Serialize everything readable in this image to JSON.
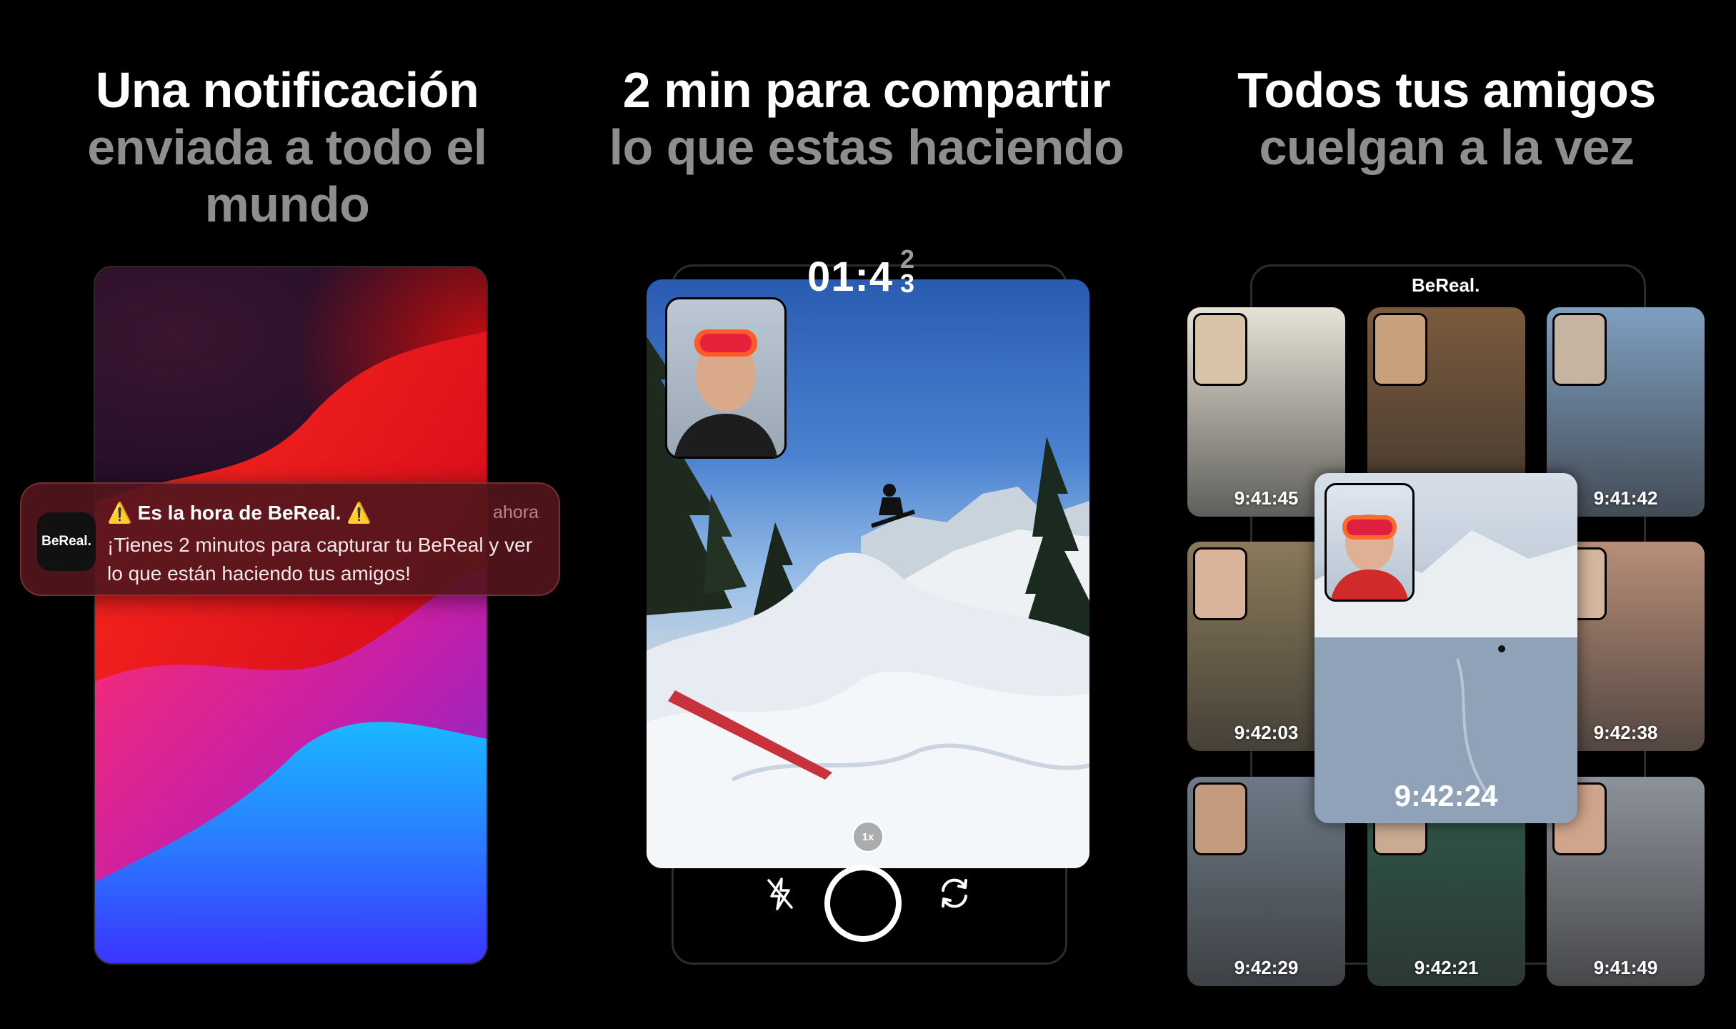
{
  "panels": [
    {
      "headline_line1": "Una notificación",
      "headline_line2": "enviada a todo el mundo"
    },
    {
      "headline_line1": "2 min para compartir",
      "headline_line2": "lo que estas haciendo"
    },
    {
      "headline_line1": "Todos tus amigos",
      "headline_line2": "cuelgan a la vez"
    }
  ],
  "notification": {
    "app_icon_label": "BeReal.",
    "warning_glyph": "⚠️",
    "title": "Es la hora de BeReal.",
    "time": "ahora",
    "body": "¡Tienes 2 minutos para capturar tu BeReal y ver lo que están haciendo tus amigos!"
  },
  "camera": {
    "timer_prefix": "01:4",
    "timer_digit_prev": "2",
    "timer_digit_next": "3",
    "zoom_label": "1x"
  },
  "feed": {
    "brand": "BeReal.",
    "featured_time": "9:42:24",
    "tiles": [
      {
        "time": "9:41:45",
        "bg": "#e7e2d6"
      },
      {
        "time": "",
        "bg": "#7b5a3c"
      },
      {
        "time": "9:41:42",
        "bg": "#7f9fc0"
      },
      {
        "time": "9:42:03",
        "bg": "#8a7a5a"
      },
      {
        "time": "9:42:38",
        "bg": "#b88e78"
      },
      {
        "time": "9:42:29",
        "bg": "#6d7a86"
      },
      {
        "time": "9:42:21",
        "bg": "#2f5a4a"
      },
      {
        "time": "9:41:49",
        "bg": "#8d929a"
      }
    ]
  },
  "colors": {
    "headline_primary": "#ffffff",
    "headline_secondary": "#8e8e8e",
    "notification_bg": "#52161c",
    "warning": "#ffc400"
  },
  "icons": [
    "app-icon",
    "warning-icon",
    "flash-off-icon",
    "shutter-button",
    "flip-camera-icon",
    "zoom-icon"
  ]
}
